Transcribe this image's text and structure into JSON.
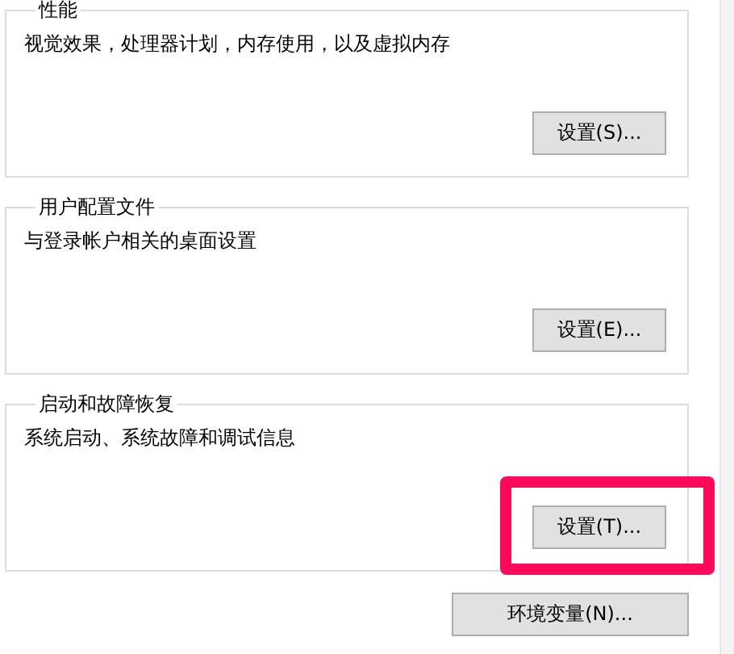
{
  "groups": [
    {
      "title": "性能",
      "description": "视觉效果，处理器计划，内存使用，以及虚拟内存",
      "button": {
        "label": "设置(S)...",
        "highlighted": false
      }
    },
    {
      "title": "用户配置文件",
      "description": "与登录帐户相关的桌面设置",
      "button": {
        "label": "设置(E)...",
        "highlighted": false
      }
    },
    {
      "title": "启动和故障恢复",
      "description": "系统启动、系统故障和调试信息",
      "button": {
        "label": "设置(T)...",
        "highlighted": true
      }
    }
  ],
  "bottom_button": {
    "label": "环境变量(N)..."
  }
}
